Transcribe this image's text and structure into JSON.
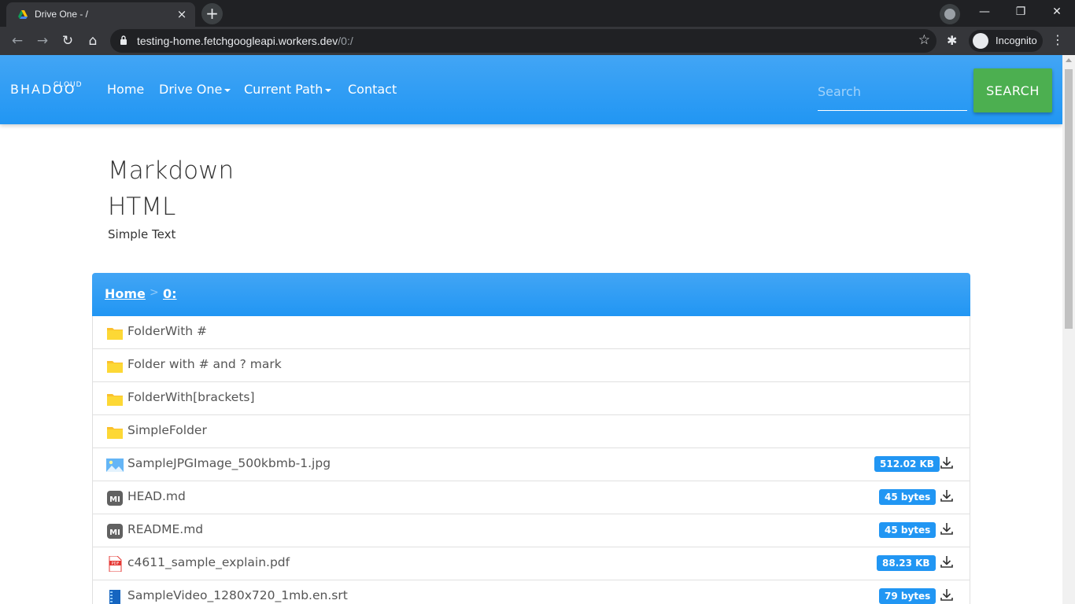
{
  "browser": {
    "tab_title": "Drive One - /",
    "tab_close": "×",
    "new_tab": "+",
    "url_host": "testing-home.fetchgoogleapi.workers.dev",
    "url_path": "/0:/",
    "incognito_label": "Incognito",
    "window_controls": [
      "—",
      "❐",
      "✕"
    ]
  },
  "navbar": {
    "brand_top": "CLOUD",
    "brand": "BHADOO",
    "links": [
      {
        "label": "Home"
      },
      {
        "label": "Drive One",
        "dropdown": true
      },
      {
        "label": "Current Path",
        "dropdown": true
      },
      {
        "label": "Contact"
      }
    ],
    "search_placeholder": "Search",
    "search_button": "SEARCH"
  },
  "readme": {
    "heading1": "Markdown",
    "heading2": "HTML",
    "text": "Simple Text"
  },
  "breadcrumb": {
    "items": [
      "Home",
      "0:"
    ],
    "separator": ">"
  },
  "files": [
    {
      "name": "FolderWith #",
      "type": "folder"
    },
    {
      "name": "Folder with # and ? mark",
      "type": "folder"
    },
    {
      "name": "FolderWith[brackets]",
      "type": "folder"
    },
    {
      "name": "SimpleFolder",
      "type": "folder"
    },
    {
      "name": "SampleJPGImage_500kbmb-1.jpg",
      "type": "image",
      "size": "512.02 KB"
    },
    {
      "name": "HEAD.md",
      "type": "markdown",
      "size": "45 bytes"
    },
    {
      "name": "README.md",
      "type": "markdown",
      "size": "45 bytes"
    },
    {
      "name": "c4611_sample_explain.pdf",
      "type": "pdf",
      "size": "88.23 KB"
    },
    {
      "name": "SampleVideo_1280x720_1mb.en.srt",
      "type": "subtitle",
      "size": "79 bytes"
    }
  ],
  "colors": {
    "primary": "#2196f3",
    "primary_light": "#42a5f5",
    "search_button": "#4caf50",
    "folder": "#fbc02d"
  }
}
